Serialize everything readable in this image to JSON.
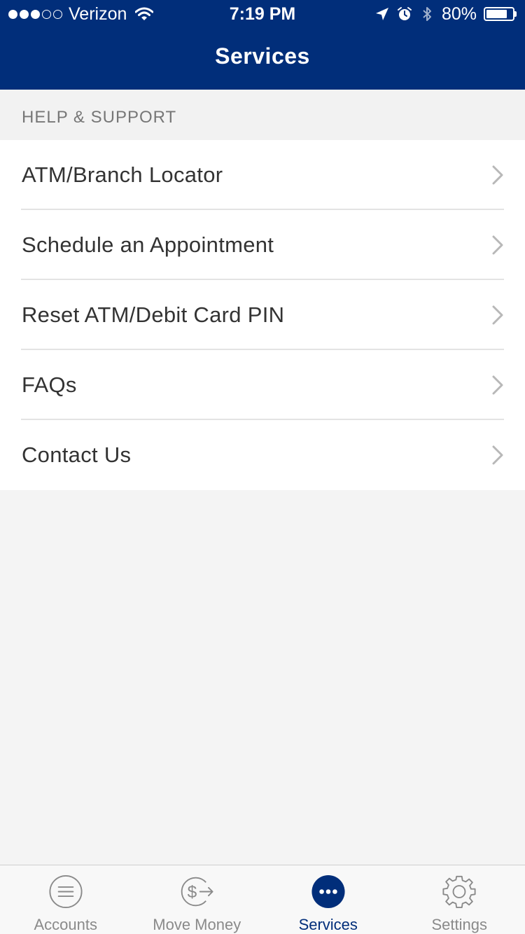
{
  "status_bar": {
    "carrier": "Verizon",
    "time": "7:19 PM",
    "battery": "80%",
    "battery_level": 0.8,
    "icons": [
      "signal-icon",
      "wifi-icon",
      "location-icon",
      "alarm-icon",
      "bluetooth-icon",
      "battery-icon"
    ]
  },
  "header": {
    "title": "Services",
    "background": "#012e7a"
  },
  "section": {
    "title": "HELP & SUPPORT"
  },
  "list": {
    "items": [
      {
        "label": "ATM/Branch Locator"
      },
      {
        "label": "Schedule an Appointment"
      },
      {
        "label": "Reset ATM/Debit Card PIN"
      },
      {
        "label": "FAQs"
      },
      {
        "label": "Contact Us"
      }
    ]
  },
  "tab_bar": {
    "tabs": [
      {
        "label": "Accounts",
        "icon": "list-icon",
        "active": false
      },
      {
        "label": "Move Money",
        "icon": "dollar-transfer-icon",
        "active": false
      },
      {
        "label": "Services",
        "icon": "more-dots-icon",
        "active": true
      },
      {
        "label": "Settings",
        "icon": "gear-icon",
        "active": false
      }
    ],
    "active_color": "#012e7a"
  }
}
